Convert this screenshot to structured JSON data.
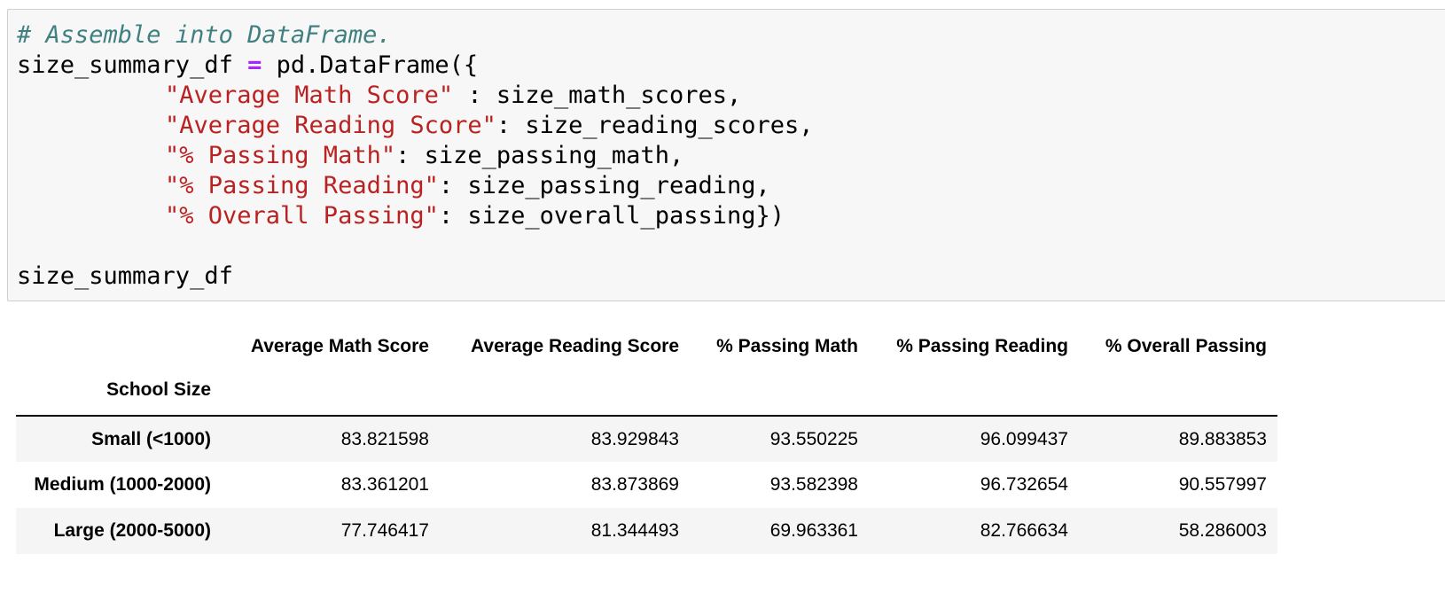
{
  "code_cell": {
    "comment": "# Assemble into DataFrame.",
    "line_assign_var": "size_summary_df ",
    "line_assign_op": "=",
    "line_assign_call": " pd.DataFrame({",
    "entries": [
      {
        "key": "\"Average Math Score\"",
        "rest": " : size_math_scores,"
      },
      {
        "key": "\"Average Reading Score\"",
        "rest": ": size_reading_scores,"
      },
      {
        "key": "\"% Passing Math\"",
        "rest": ": size_passing_math,"
      },
      {
        "key": "\"% Passing Reading\"",
        "rest": ": size_passing_reading,"
      },
      {
        "key": "\"% Overall Passing\"",
        "rest": ": size_overall_passing})"
      }
    ],
    "final_line": "size_summary_df"
  },
  "output_table": {
    "columns": [
      "Average Math Score",
      "Average Reading Score",
      "% Passing Math",
      "% Passing Reading",
      "% Overall Passing"
    ],
    "index_name": "School Size",
    "rows": [
      {
        "label": "Small (<1000)",
        "values": [
          "83.821598",
          "83.929843",
          "93.550225",
          "96.099437",
          "89.883853"
        ]
      },
      {
        "label": "Medium (1000-2000)",
        "values": [
          "83.361201",
          "83.873869",
          "93.582398",
          "96.732654",
          "90.557997"
        ]
      },
      {
        "label": "Large (2000-5000)",
        "values": [
          "77.746417",
          "81.344493",
          "69.963361",
          "82.766634",
          "58.286003"
        ]
      }
    ]
  },
  "colors": {
    "comment": "#408080",
    "operator": "#aa22ff",
    "string": "#ba2121",
    "cell_background": "#f7f7f7",
    "row_stripe": "#f5f5f5"
  }
}
